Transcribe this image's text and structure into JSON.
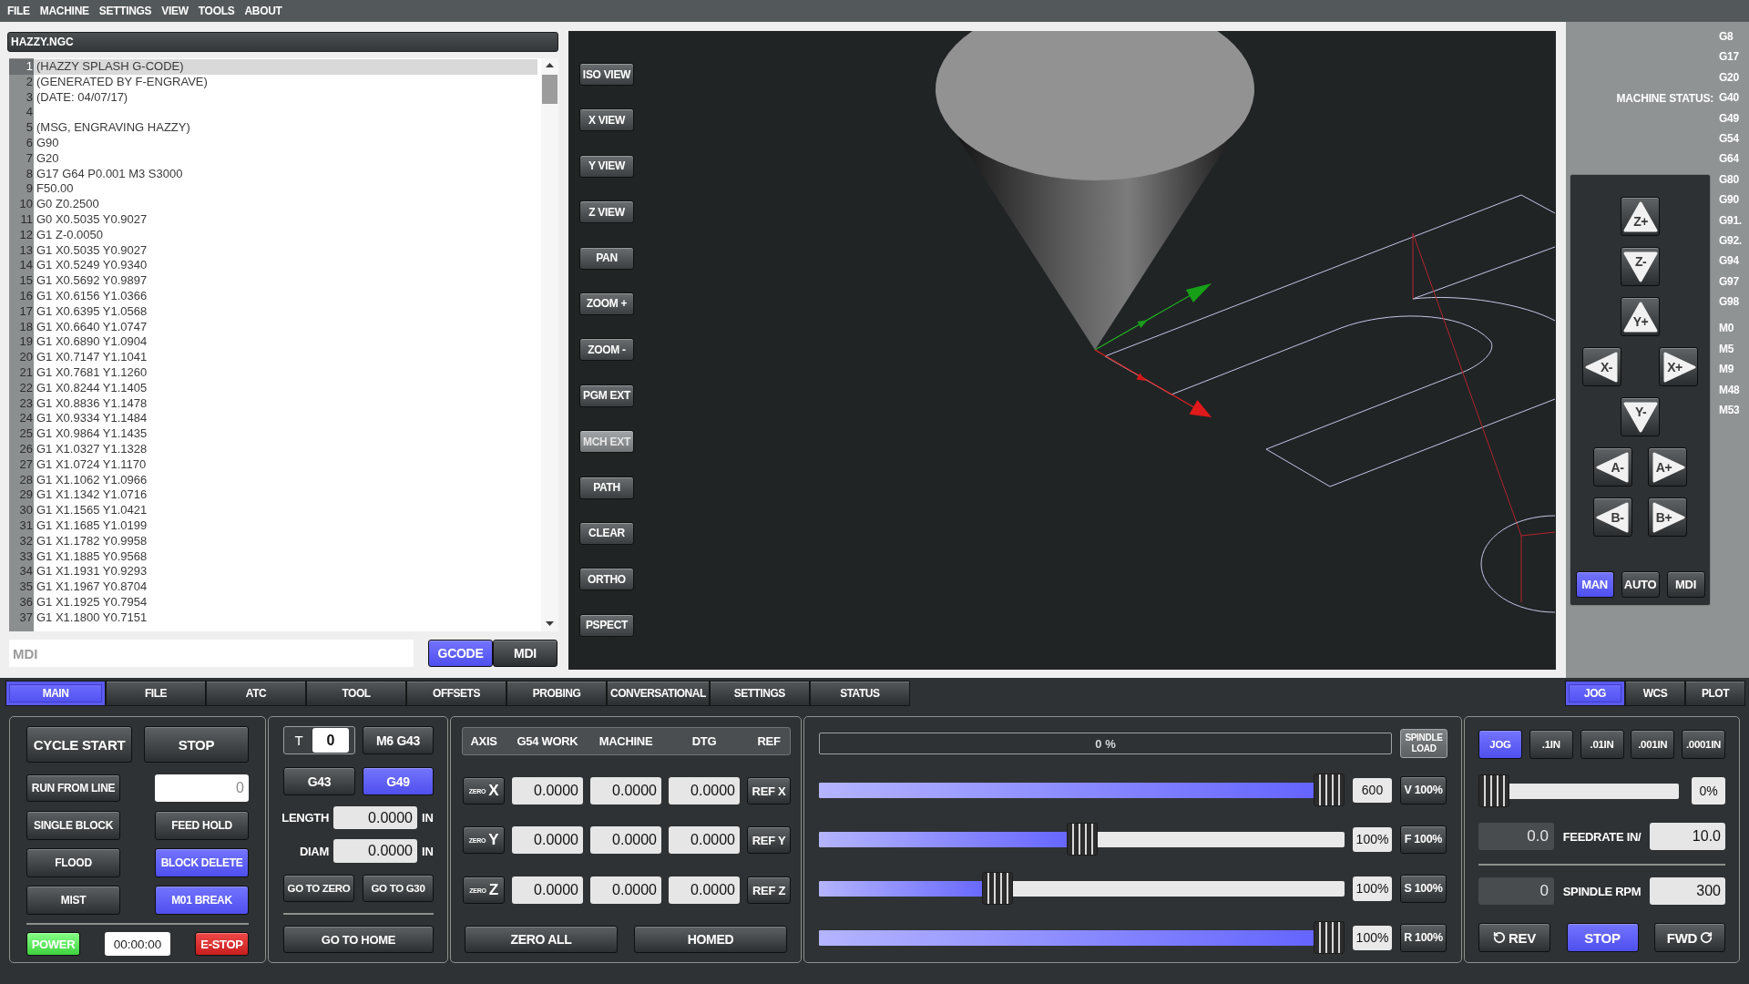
{
  "menu": [
    "FILE",
    "MACHINE",
    "SETTINGS",
    "VIEW",
    "TOOLS",
    "ABOUT"
  ],
  "file": {
    "title": "HAZZY.NGC",
    "lines": [
      {
        "number": "1",
        "code": "(HAZZY SPLASH G-CODE)",
        "selected": true
      },
      {
        "number": "2",
        "code": "(GENERATED BY F-ENGRAVE)",
        "selected": false
      },
      {
        "number": "3",
        "code": "(DATE: 04/07/17)",
        "selected": false
      },
      {
        "number": "4",
        "selected": false
      },
      {
        "number": "5",
        "code": "(MSG, ENGRAVING HAZZY)",
        "selected": false
      },
      {
        "number": "6",
        "code": "G90",
        "selected": false
      },
      {
        "number": "7",
        "code": "G20",
        "selected": false
      },
      {
        "number": "8",
        "code": "G17 G64 P0.001 M3 S3000",
        "selected": false
      },
      {
        "number": "9",
        "code": "F50.00",
        "selected": false
      },
      {
        "number": "10",
        "code": "G0 Z0.2500",
        "selected": false
      },
      {
        "number": "11",
        "code": "G0 X0.5035 Y0.9027",
        "selected": false
      },
      {
        "number": "12",
        "code": "G1 Z-0.0050",
        "selected": false
      },
      {
        "number": "13",
        "code": "G1 X0.5035 Y0.9027",
        "selected": false
      },
      {
        "number": "14",
        "code": "G1 X0.5249 Y0.9340",
        "selected": false
      },
      {
        "number": "15",
        "code": "G1 X0.5692 Y0.9897",
        "selected": false
      },
      {
        "number": "16",
        "code": "G1 X0.6156 Y1.0366",
        "selected": false
      },
      {
        "number": "17",
        "code": "G1 X0.6395 Y1.0568",
        "selected": false
      },
      {
        "number": "18",
        "code": "G1 X0.6640 Y1.0747",
        "selected": false
      },
      {
        "number": "19",
        "code": "G1 X0.6890 Y1.0904",
        "selected": false
      },
      {
        "number": "20",
        "code": "G1 X0.7147 Y1.1041",
        "selected": false
      },
      {
        "number": "21",
        "code": "G1 X0.7681 Y1.1260",
        "selected": false
      },
      {
        "number": "22",
        "code": "G1 X0.8244 Y1.1405",
        "selected": false
      },
      {
        "number": "23",
        "code": "G1 X0.8836 Y1.1478",
        "selected": false
      },
      {
        "number": "24",
        "code": "G1 X0.9334 Y1.1484",
        "selected": false
      },
      {
        "number": "25",
        "code": "G1 X0.9864 Y1.1435",
        "selected": false
      },
      {
        "number": "26",
        "code": "G1 X1.0327 Y1.1328",
        "selected": false
      },
      {
        "number": "27",
        "code": "G1 X1.0724 Y1.1170",
        "selected": false
      },
      {
        "number": "28",
        "code": "G1 X1.1062 Y1.0966",
        "selected": false
      },
      {
        "number": "29",
        "code": "G1 X1.1342 Y1.0716",
        "selected": false
      },
      {
        "number": "30",
        "code": "G1 X1.1565 Y1.0421",
        "selected": false
      },
      {
        "number": "31",
        "code": "G1 X1.1685 Y1.0199",
        "selected": false
      },
      {
        "number": "32",
        "code": "G1 X1.1782 Y0.9958",
        "selected": false
      },
      {
        "number": "33",
        "code": "G1 X1.1885 Y0.9568",
        "selected": false
      },
      {
        "number": "34",
        "code": "G1 X1.1931 Y0.9293",
        "selected": false
      },
      {
        "number": "35",
        "code": "G1 X1.1967 Y0.8704",
        "selected": false
      },
      {
        "number": "36",
        "code": "G1 X1.1925 Y0.7954",
        "selected": false
      },
      {
        "number": "37",
        "code": "G1 X1.1800 Y0.7151",
        "selected": false
      }
    ]
  },
  "mdi": {
    "placeholder": "MDI",
    "modes": [
      {
        "label": "GCODE",
        "selected": true
      },
      {
        "label": "MDI",
        "selected": false
      }
    ]
  },
  "view_buttons": [
    {
      "label": "ISO VIEW",
      "selected": false
    },
    {
      "label": "X VIEW",
      "selected": false
    },
    {
      "label": "Y VIEW",
      "selected": false
    },
    {
      "label": "Z VIEW",
      "selected": false
    },
    {
      "label": "PAN",
      "selected": false
    },
    {
      "label": "ZOOM +",
      "selected": false
    },
    {
      "label": "ZOOM -",
      "selected": false
    },
    {
      "label": "PGM EXT",
      "selected": false
    },
    {
      "label": "MCH EXT",
      "selected": true
    },
    {
      "label": "PATH",
      "selected": false
    },
    {
      "label": "CLEAR",
      "selected": false
    },
    {
      "label": "ORTHO",
      "selected": false
    },
    {
      "label": "PSPECT",
      "selected": false
    }
  ],
  "machine_status": {
    "label": "MACHINE STATUS:",
    "g_codes": [
      "G8",
      "G17",
      "G20",
      "G40",
      "G49",
      "G54",
      "G64",
      "G80",
      "G90",
      "G91.",
      "G92.",
      "G94",
      "G97",
      "G98"
    ],
    "m_codes": [
      "M0",
      "M5",
      "M9",
      "M48",
      "M53"
    ]
  },
  "jog": {
    "rows": [
      [
        {
          "label": "Z+",
          "kind": "up"
        }
      ],
      [
        {
          "label": "Z-",
          "kind": "down"
        }
      ],
      [
        {
          "label": "Y+",
          "kind": "up"
        }
      ],
      [
        {
          "label": "X-",
          "kind": "left"
        },
        {
          "label": "X+",
          "kind": "right"
        }
      ],
      [
        {
          "label": "Y-",
          "kind": "down"
        }
      ],
      [
        {
          "label": "A-",
          "kind": "left"
        },
        {
          "label": "A+",
          "kind": "right"
        }
      ],
      [
        {
          "label": "B-",
          "kind": "left"
        },
        {
          "label": "B+",
          "kind": "right"
        }
      ]
    ],
    "modes": [
      {
        "label": "MAN",
        "selected": true
      },
      {
        "label": "AUTO",
        "selected": false
      },
      {
        "label": "MDI",
        "selected": false
      }
    ]
  },
  "tabs": [
    {
      "label": "MAIN",
      "selected": true
    },
    {
      "label": "FILE",
      "selected": false
    },
    {
      "label": "ATC",
      "selected": false
    },
    {
      "label": "TOOL",
      "selected": false
    },
    {
      "label": "OFFSETS",
      "selected": false
    },
    {
      "label": "PROBING",
      "selected": false
    },
    {
      "label": "CONVERSATIONAL",
      "selected": false
    },
    {
      "label": "SETTINGS",
      "selected": false
    },
    {
      "label": "STATUS",
      "selected": false
    }
  ],
  "side_tabs": [
    {
      "label": "JOG",
      "selected": true
    },
    {
      "label": "WCS",
      "selected": false
    },
    {
      "label": "PLOT",
      "selected": false
    }
  ],
  "program": {
    "start_buttons": [
      {
        "label": "CYCLE START",
        "selected": false
      },
      {
        "label": "STOP",
        "selected": false
      }
    ],
    "run_from_line": {
      "label": "RUN FROM LINE",
      "placeholder": "0"
    },
    "toggles": [
      {
        "label": "SINGLE BLOCK",
        "selected": false
      },
      {
        "label": "FEED HOLD",
        "selected": false
      },
      {
        "label": "FLOOD",
        "selected": false
      },
      {
        "label": "BLOCK DELETE",
        "selected": true
      },
      {
        "label": "MIST",
        "selected": false
      },
      {
        "label": "M01 BREAK",
        "selected": true
      }
    ],
    "power": {
      "label": "POWER",
      "on": true
    },
    "timer": "00:00:00",
    "estop": {
      "label": "E-STOP",
      "active": true
    }
  },
  "tool": {
    "number_label": "T",
    "number": "0",
    "change_button": "M6 G43",
    "offset_modes": [
      {
        "label": "G43",
        "selected": false
      },
      {
        "label": "G49",
        "selected": true
      }
    ],
    "fields": [
      {
        "label": "LENGTH",
        "value": "0.0000",
        "unit": "IN"
      },
      {
        "label": "DIAM",
        "value": "0.0000",
        "unit": "IN"
      }
    ],
    "goto_buttons": [
      "GO TO ZERO",
      "GO TO G30"
    ],
    "home_button": "GO TO HOME"
  },
  "position": {
    "columns": [
      "AXIS",
      "G54 WORK",
      "MACHINE",
      "DTG",
      "REF"
    ],
    "axes": [
      {
        "zero": "ZERO",
        "axis": "X",
        "values": [
          "0.0000",
          "0.0000",
          "0.0000"
        ],
        "ref": "REF X"
      },
      {
        "zero": "ZERO",
        "axis": "Y",
        "values": [
          "0.0000",
          "0.0000",
          "0.0000"
        ],
        "ref": "REF Y"
      },
      {
        "zero": "ZERO",
        "axis": "Z",
        "values": [
          "0.0000",
          "0.0000",
          "0.0000"
        ],
        "ref": "REF Z"
      }
    ],
    "buttons": [
      "ZERO ALL",
      "HOMED"
    ]
  },
  "overrides": {
    "spindle_load": {
      "level": 0,
      "reading": "0 %",
      "button": "SPINDLE LOAD"
    },
    "sliders": [
      {
        "level": 1,
        "value": "600",
        "button": "V 100%"
      },
      {
        "level": 0.5,
        "value": "100%",
        "button": "F 100%"
      },
      {
        "level": 0.33,
        "value": "100%",
        "button": "S 100%"
      },
      {
        "level": 1,
        "value": "100%",
        "button": "R 100%"
      }
    ]
  },
  "manual": {
    "increments": [
      {
        "label": "JOG",
        "selected": true
      },
      {
        "label": ".1IN",
        "selected": false
      },
      {
        "label": ".01IN",
        "selected": false
      },
      {
        "label": ".001IN",
        "selected": false
      },
      {
        "label": ".0001IN",
        "selected": false
      }
    ],
    "jog_speed": {
      "level": 0,
      "value": "0%"
    },
    "feedrate": {
      "reading": "0.0",
      "label": "FEEDRATE IN/",
      "value": "10.0"
    },
    "spindle": {
      "reading": "0",
      "label": "SPINDLE RPM",
      "value": "300"
    },
    "spindle_buttons": [
      {
        "label": "REV",
        "kind": "reverse",
        "selected": false
      },
      {
        "label": "STOP",
        "kind": "stop",
        "selected": true
      },
      {
        "label": "FWD",
        "kind": "forward",
        "selected": false
      }
    ]
  }
}
